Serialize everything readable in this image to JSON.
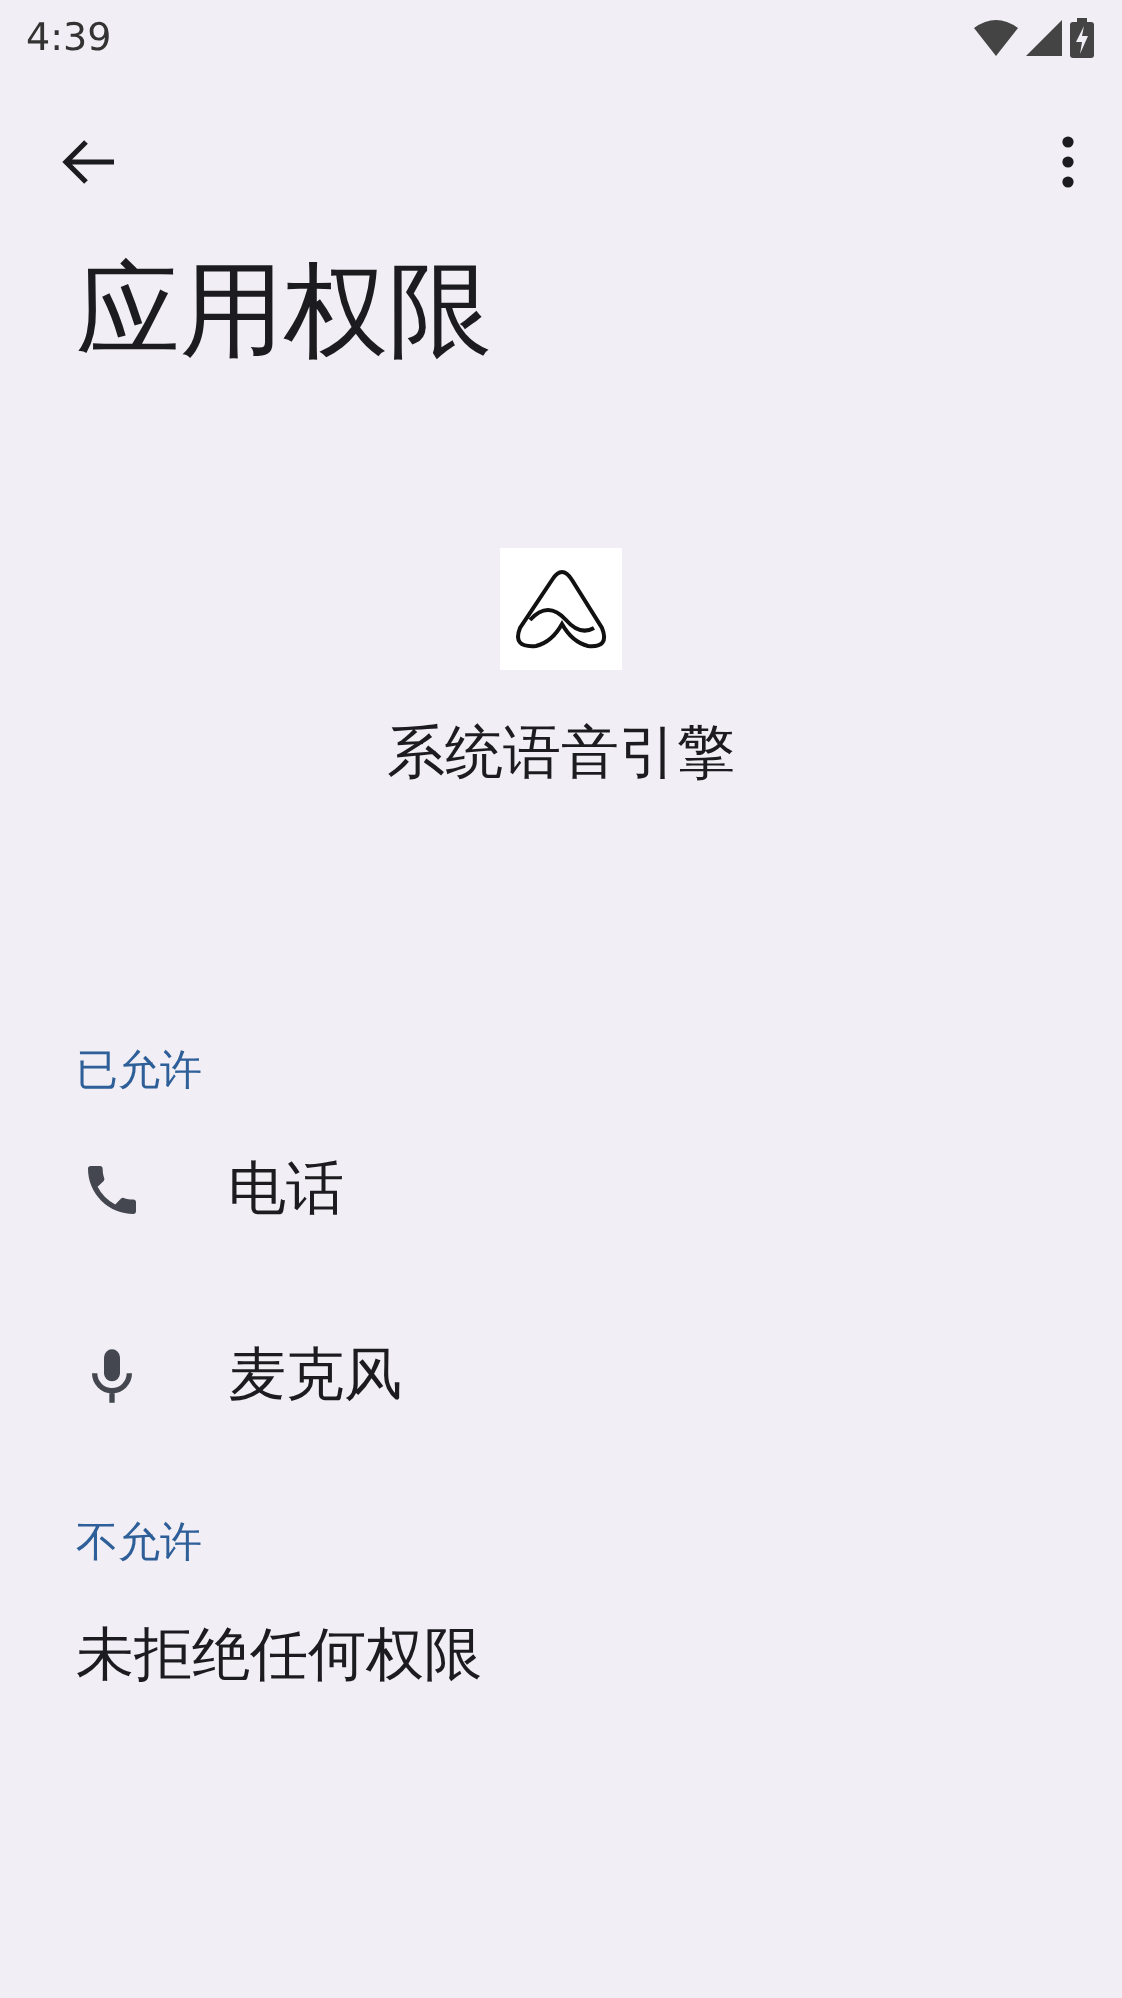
{
  "status_bar": {
    "time": "4:39"
  },
  "title": "应用权限",
  "app": {
    "name": "系统语音引擎"
  },
  "sections": [
    {
      "header": "已允许",
      "items": [
        {
          "kind": "phone",
          "label": "电话"
        },
        {
          "kind": "microphone",
          "label": "麦克风"
        }
      ]
    },
    {
      "header": "不允许",
      "items": [
        {
          "kind": "message",
          "label": "未拒绝任何权限"
        }
      ]
    }
  ]
}
